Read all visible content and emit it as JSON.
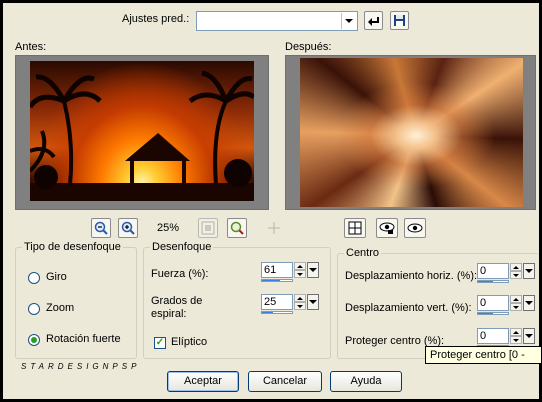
{
  "presets": {
    "label": "Ajustes pred.:",
    "value": ""
  },
  "preview": {
    "before_label": "Antes:",
    "after_label": "Después:",
    "zoom": "25%"
  },
  "blur_type": {
    "title": "Tipo de desenfoque",
    "options": [
      {
        "label": "Giro",
        "selected": false
      },
      {
        "label": "Zoom",
        "selected": false
      },
      {
        "label": "Rotación fuerte",
        "selected": true
      }
    ]
  },
  "blur": {
    "title": "Desenfoque",
    "strength_label": "Fuerza (%):",
    "strength_value": "61",
    "strength_fraction": 0.61,
    "spiral_label_1": "Grados de",
    "spiral_label_2": "espiral:",
    "spiral_value": "25",
    "spiral_fraction": 0.35,
    "elliptic_label": "Elíptico",
    "elliptic_checked": true
  },
  "center": {
    "title": "Centro",
    "h_offset_label": "Desplazamiento horiz. (%):",
    "h_offset_value": "0",
    "v_offset_label": "Desplazamiento vert. (%):",
    "v_offset_value": "0",
    "protect_label": "Proteger centro (%):",
    "protect_value": "0"
  },
  "tooltip": "Proteger centro [0 -",
  "watermark": "STARDESIGNPSP",
  "buttons": {
    "ok": "Aceptar",
    "cancel": "Cancelar",
    "help": "Ayuda"
  },
  "colors": {
    "background": "#ece9d8",
    "accent": "#3d7fe0",
    "radio_dot": "#21a121"
  }
}
